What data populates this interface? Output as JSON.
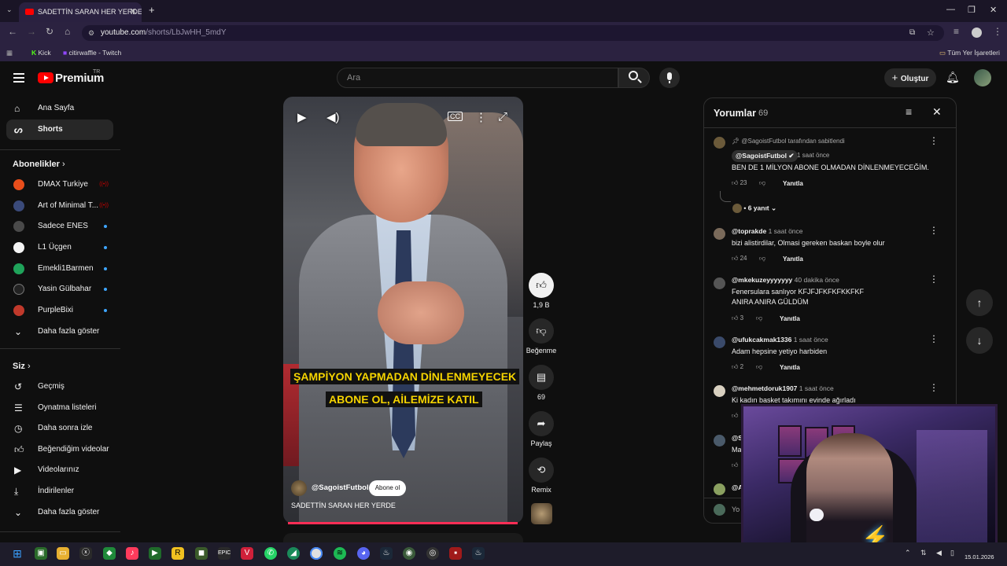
{
  "browser": {
    "tab_title": "SADETTİN SARAN HER YERDE",
    "url_host": "youtube.com",
    "url_path": "/shorts/LbJwHH_5mdY",
    "bookmarks": [
      "Kick",
      "citirwaffle - Twitch"
    ],
    "all_bookmarks": "Tüm Yer İşaretleri"
  },
  "header": {
    "logo": "Premium",
    "logo_region": "TR",
    "search_placeholder": "Ara",
    "create_label": "Oluştur"
  },
  "sidebar": {
    "main": [
      {
        "label": "Ana Sayfa",
        "icon": "home-icon"
      },
      {
        "label": "Shorts",
        "icon": "shorts-icon",
        "active": true
      }
    ],
    "subs_title": "Abonelikler",
    "subs": [
      {
        "label": "DMAX Turkiye",
        "color": "#e94e1b",
        "live": true
      },
      {
        "label": "Art of Minimal T...",
        "color": "#3a4a7a",
        "live": true
      },
      {
        "label": "Sadece ENES",
        "color": "#4a4a4a",
        "live": false
      },
      {
        "label": "L1 Üçgen",
        "color": "#f4f4f4",
        "live": false
      },
      {
        "label": "Emekli1Barmen",
        "color": "#1fa35a",
        "live": false
      },
      {
        "label": "Yasin Gülbahar",
        "color": "#222222",
        "live": false
      },
      {
        "label": "PurpleBixi",
        "color": "#c0392b",
        "live": false
      }
    ],
    "show_more": "Daha fazla göster",
    "you_title": "Siz",
    "you": [
      {
        "label": "Geçmiş",
        "icon": "history-icon"
      },
      {
        "label": "Oynatma listeleri",
        "icon": "playlist-icon"
      },
      {
        "label": "Daha sonra izle",
        "icon": "clock-icon"
      },
      {
        "label": "Beğendiğim videolar",
        "icon": "thumb-up-icon"
      },
      {
        "label": "Videolarınız",
        "icon": "video-icon"
      },
      {
        "label": "İndirilenler",
        "icon": "download-icon"
      }
    ],
    "you_more": "Daha fazla göster"
  },
  "short": {
    "caption_line1": "ŞAMPİYON YAPMADAN DİNLENMEYECEK",
    "caption_line2": "ABONE OL, AİLEMİZE KATIL",
    "channel": "@SagoistFutbol",
    "subscribe": "Abone ol",
    "title": "SADETTİN SARAN HER YERDE",
    "likes": "1,9 B",
    "dislike_label": "Beğenme",
    "comments": "69",
    "share": "Paylaş",
    "remix": "Remix"
  },
  "comments": {
    "title": "Yorumlar",
    "count": "69",
    "pinned_by": "@SagoistFutbol tarafından sabitlendi",
    "reply_label": "Yanıtla",
    "items": [
      {
        "author": "@SagoistFutbol",
        "time": "1 saat önce",
        "text": [
          "BEN DE 1 MİLYON ABONE OLMADAN DİNLENMEYECEĞİM."
        ],
        "likes": "23",
        "replies": "6 yanıt",
        "avatar_color": "#6b5a3a"
      },
      {
        "author": "@toprakde",
        "time": "1 saat önce",
        "text": [
          "bizi alistirdilar, Olmasi gereken baskan boyle olur"
        ],
        "likes": "24",
        "avatar_color": "#7a6a5a"
      },
      {
        "author": "@mkekuzeyyyyyyy",
        "time": "40 dakika önce",
        "text": [
          "Fenersulara sanlıyor KFJFJFKFKFKKFKF",
          "ANIRA ANIRA GÜLDÜM"
        ],
        "likes": "3",
        "avatar_color": "#555555"
      },
      {
        "author": "@ufukcakmak1336",
        "time": "1 saat önce",
        "text": [
          "Adam hepsine yetiyo harbiden"
        ],
        "likes": "2",
        "avatar_color": "#3a4a6a"
      },
      {
        "author": "@mehmetdoruk1907",
        "time": "1 saat önce",
        "text": [
          "Ki kadın basket takımını evinde ağırladı"
        ],
        "likes": "",
        "avatar_color": "#d8d0c0"
      }
    ],
    "partial": [
      {
        "author": "@S",
        "text": "Ma",
        "avatar_color": "#4a5a6a"
      },
      {
        "author": "@A",
        "avatar_color": "#8aa060"
      }
    ],
    "input_placeholder": "Yo"
  },
  "taskbar": {
    "date": "15.01.2026"
  }
}
